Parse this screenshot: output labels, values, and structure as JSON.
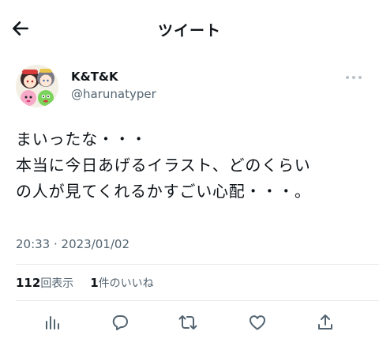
{
  "header": {
    "title": "ツイート",
    "back_icon": "back-arrow-icon"
  },
  "author": {
    "display_name": "K&T&K",
    "handle": "@harunatyper"
  },
  "tweet": {
    "lines": [
      "まいったな・・・",
      "本当に今日あげるイラスト、どのくらい",
      "の人が見てくれるかすごい心配・・・。"
    ],
    "timestamp": "20:33 · 2023/01/02"
  },
  "stats": {
    "views_count": "112",
    "views_label": "回表示",
    "likes_count": "1",
    "likes_label": "件のいいね"
  },
  "actions": {
    "icons": [
      "analytics-icon",
      "reply-icon",
      "retweet-icon",
      "like-icon",
      "share-icon"
    ]
  },
  "colors": {
    "text": "#0f1419",
    "secondary_text": "#536471",
    "divider": "#e7e9ea"
  }
}
